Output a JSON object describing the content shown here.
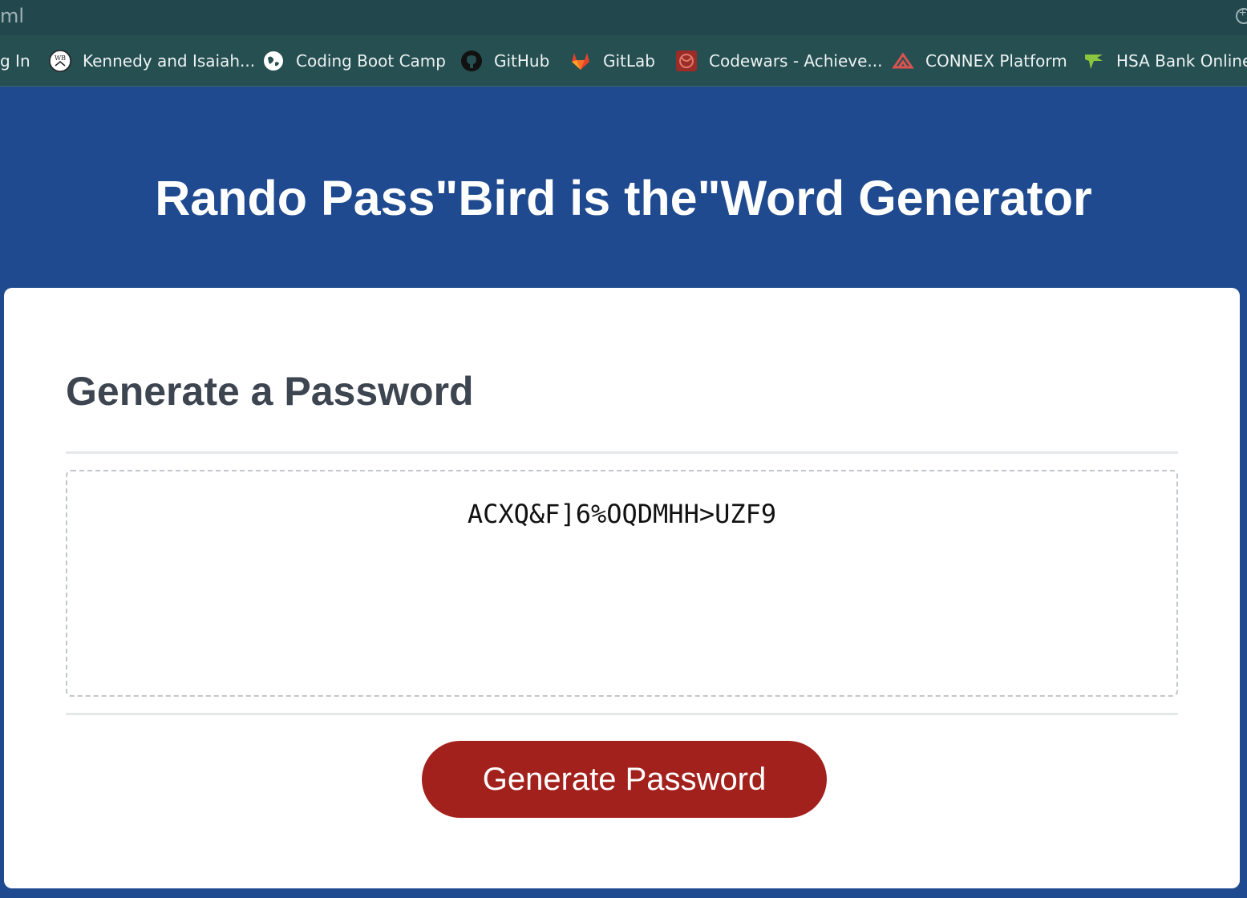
{
  "browser": {
    "url_fragment": "ml",
    "bookmarks": [
      {
        "label": "g In",
        "icon": "none"
      },
      {
        "label": "Kennedy and Isaiah...",
        "icon": "wb-logo-icon"
      },
      {
        "label": "Coding Boot Camp",
        "icon": "globe-icon"
      },
      {
        "label": "GitHub",
        "icon": "github-icon"
      },
      {
        "label": "GitLab",
        "icon": "gitlab-icon"
      },
      {
        "label": "Codewars - Achieve...",
        "icon": "codewars-icon"
      },
      {
        "label": "CONNEX Platform",
        "icon": "connex-icon"
      },
      {
        "label": "HSA Bank Online",
        "icon": "hsa-bank-icon"
      }
    ]
  },
  "header": {
    "title": "Rando Pass\"Bird is the\"Word Generator"
  },
  "card": {
    "title": "Generate a Password",
    "password_output": "ACXQ&F]6%OQDMHH>UZF9",
    "generate_button_label": "Generate Password"
  },
  "colors": {
    "header_bg": "#1f4a8f",
    "button_bg": "#a3211c",
    "card_title": "#3d4550"
  }
}
